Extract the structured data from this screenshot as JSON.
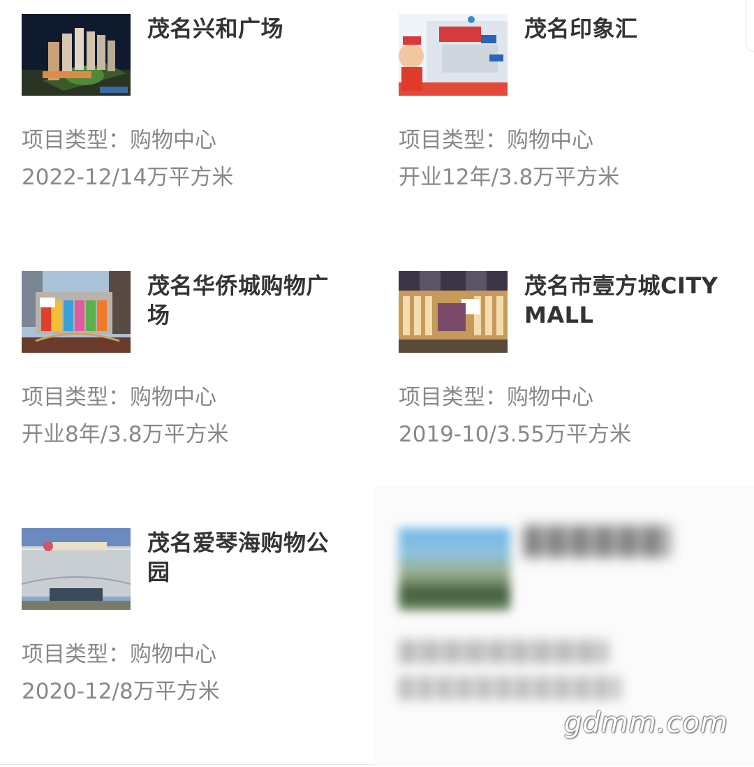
{
  "items": [
    {
      "title": "茂名兴和广场",
      "type_line": "项目类型：购物中心",
      "info_line": "2022-12/14万平方米"
    },
    {
      "title": "茂名印象汇",
      "type_line": "项目类型：购物中心",
      "info_line": "开业12年/3.8万平方米"
    },
    {
      "title": "茂名华侨城购物广场",
      "type_line": "项目类型：购物中心",
      "info_line": "开业8年/3.8万平方米"
    },
    {
      "title": "茂名市壹方城CITY MALL",
      "type_line": "项目类型：购物中心",
      "info_line": "2019-10/3.55万平方米"
    },
    {
      "title": "茂名爱琴海购物公园",
      "type_line": "项目类型：购物中心",
      "info_line": "2020-12/8万平方米"
    }
  ],
  "watermark": "gdmm.com",
  "colors": {
    "title": "#333333",
    "secondary_text": "#888888",
    "divider": "#e6e6e6"
  }
}
